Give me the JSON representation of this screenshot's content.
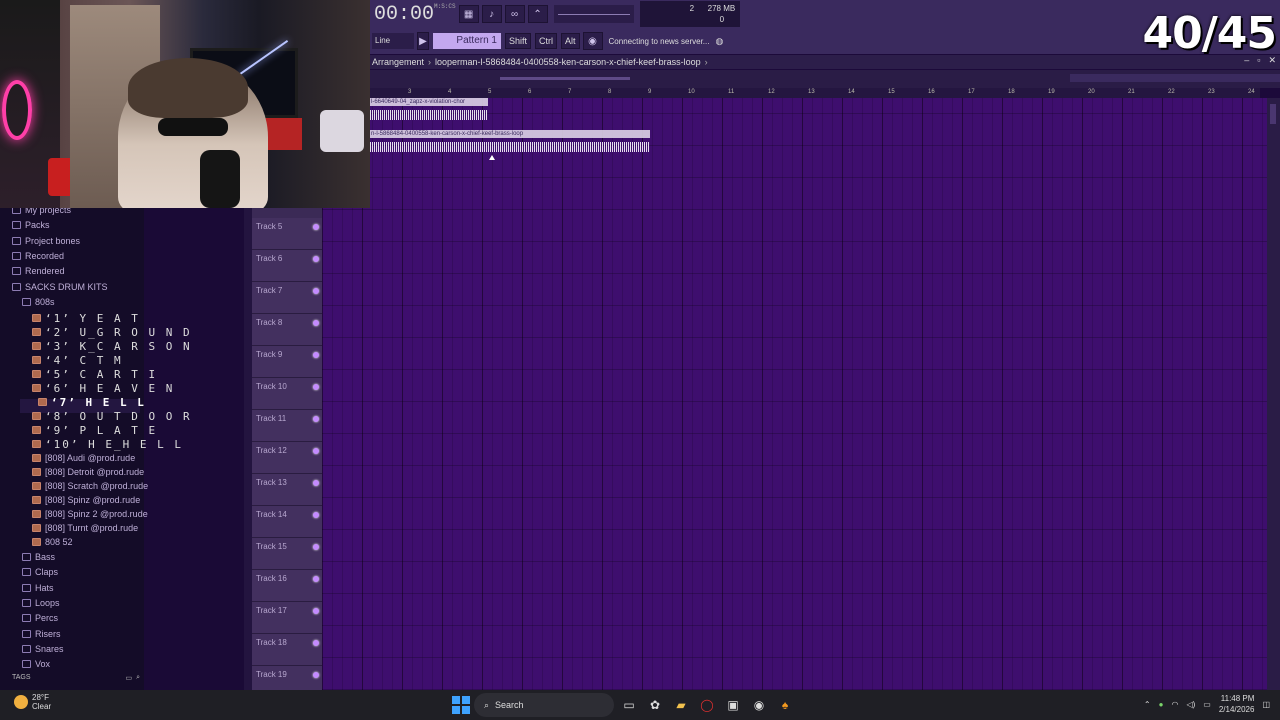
{
  "overlay": {
    "counter": "40/45"
  },
  "toolbar": {
    "time": "00:00",
    "time_unit": "M:S:CS",
    "pattern": "Pattern 1",
    "snap": "Line",
    "mod_keys": [
      "Shift",
      "Ctrl",
      "Alt"
    ],
    "news": "Connecting to news server...",
    "cpu_value": "2",
    "ram": "278 MB",
    "voices": "0"
  },
  "arrangement": {
    "title": "Arrangement",
    "file": "looperman-l-5868484-0400558-ken-carson-x-chief-keef-brass-loop",
    "win_controls": [
      "–",
      "▫",
      "✕"
    ]
  },
  "ruler": {
    "ticks": [
      "3",
      "4",
      "5",
      "6",
      "7",
      "8",
      "9",
      "10",
      "11",
      "12",
      "13",
      "14",
      "15",
      "16",
      "17",
      "18",
      "19",
      "20",
      "21",
      "22",
      "23",
      "24"
    ]
  },
  "clips": [
    {
      "label": "l-6640649-04_zapz-x-violation-chor"
    },
    {
      "label": "n-l-5868484-0400558-ken-carson-x-chief-keef-brass-loop"
    }
  ],
  "tracks": [
    "Track 5",
    "Track 6",
    "Track 7",
    "Track 8",
    "Track 9",
    "Track 10",
    "Track 11",
    "Track 12",
    "Track 13",
    "Track 14",
    "Track 15",
    "Track 16",
    "Track 17",
    "Track 18",
    "Track 19"
  ],
  "browser": {
    "top_items": [
      "My projects",
      "Packs",
      "Project bones",
      "Recorded",
      "Rendered",
      "SACKS DRUM KITS",
      "808s"
    ],
    "kit_items": [
      "‘1’  Y E A T",
      "‘2’  U_G R O U N D",
      "‘3’  K_C A R S O N",
      "‘4’  C T M",
      "‘5’  C A R T I",
      "‘6’  H E A V E N",
      "‘7’  H E L L",
      "‘8’  O U T D O O R",
      "‘9’  P L A T E",
      "‘10’  H E_H E L L"
    ],
    "files": [
      "[808] Audi @prod.rude",
      "[808] Detroit @prod.rude",
      "[808] Scratch @prod.rude",
      "[808] Spinz @prod.rude",
      "[808] Spinz 2 @prod.rude",
      "[808] Turnt @prod.rude",
      "808 52"
    ],
    "folders": [
      "Bass",
      "Claps",
      "Hats",
      "Loops",
      "Percs",
      "Risers",
      "Snares",
      "Vox"
    ],
    "tags": "TAGS"
  },
  "taskbar": {
    "temp": "28°F",
    "weather": "Clear",
    "search": "Search",
    "time": "11:48 PM",
    "date": "2/14/2026"
  }
}
